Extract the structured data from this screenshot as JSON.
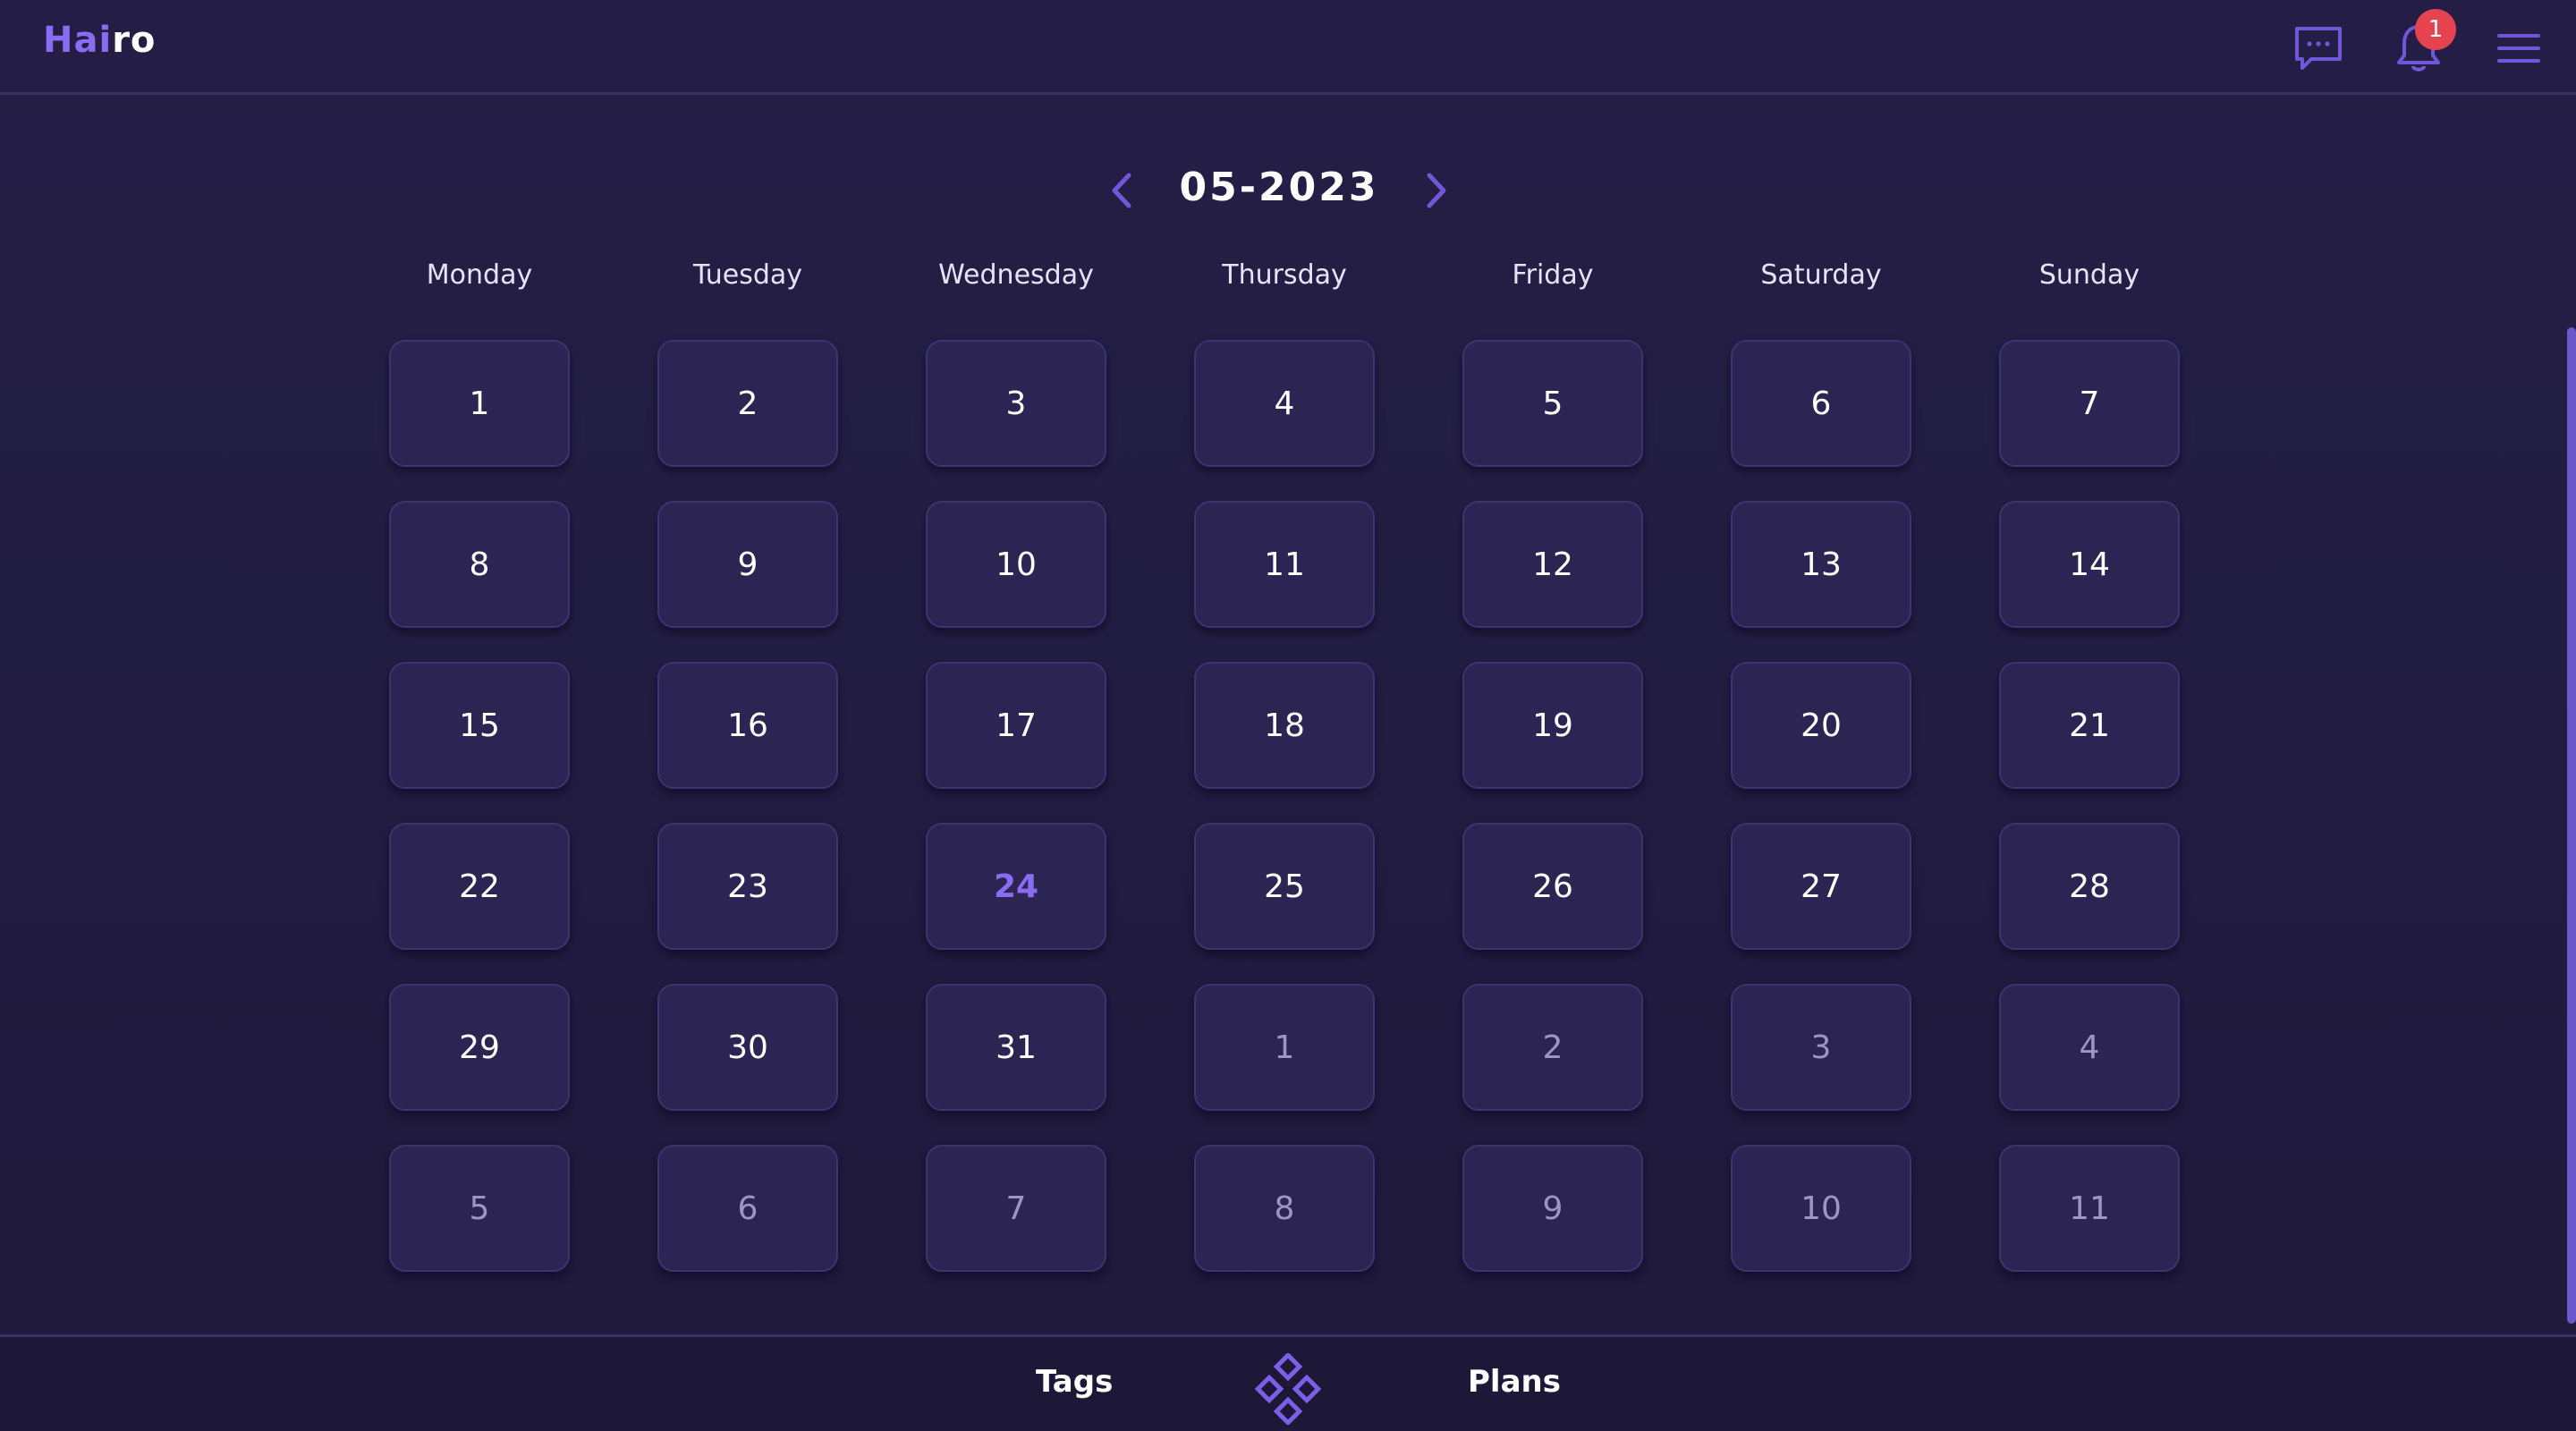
{
  "header": {
    "logo_part1": "Hai",
    "logo_part2": "ro",
    "notification_count": "1",
    "icons": [
      "chat-icon",
      "bell-icon",
      "menu-icon"
    ]
  },
  "calendar": {
    "month_label": "05-2023",
    "weekdays": [
      "Monday",
      "Tuesday",
      "Wednesday",
      "Thursday",
      "Friday",
      "Saturday",
      "Sunday"
    ],
    "today": "24",
    "weeks": [
      [
        "1",
        "2",
        "3",
        "4",
        "5",
        "6",
        "7"
      ],
      [
        "8",
        "9",
        "10",
        "11",
        "12",
        "13",
        "14"
      ],
      [
        "15",
        "16",
        "17",
        "18",
        "19",
        "20",
        "21"
      ],
      [
        "22",
        "23",
        "24",
        "25",
        "26",
        "27",
        "28"
      ],
      [
        "29",
        "30",
        "31",
        "1",
        "2",
        "3",
        "4"
      ],
      [
        "5",
        "6",
        "7",
        "8",
        "9",
        "10",
        "11"
      ]
    ]
  },
  "footer": {
    "tags_label": "Tags",
    "plans_label": "Plans"
  },
  "colors": {
    "accent": "#8a6cf0",
    "badge": "#e5434f",
    "background": "#221d40",
    "cell": "#2c2553"
  }
}
